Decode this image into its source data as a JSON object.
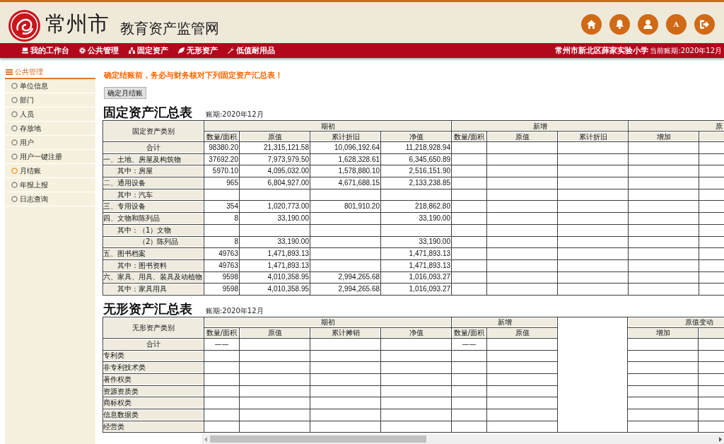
{
  "header": {
    "title": "常州市",
    "subtitle": "教育资产监管网",
    "letter_button": "A"
  },
  "nav": {
    "items": [
      "我的工作台",
      "公共管理",
      "固定资产",
      "无形资产",
      "低值耐用品"
    ],
    "school": "常州市新北区薛家实验小学",
    "period": "当前账期:2020年12月"
  },
  "sidebar": {
    "title": "公共管理",
    "items": [
      {
        "label": "单位信息",
        "selected": false
      },
      {
        "label": "部门",
        "selected": false
      },
      {
        "label": "人员",
        "selected": false
      },
      {
        "label": "存放地",
        "selected": false
      },
      {
        "label": "用户",
        "selected": false
      },
      {
        "label": "用户一键注册",
        "selected": false
      },
      {
        "label": "月结账",
        "selected": true
      },
      {
        "label": "年报上报",
        "selected": false
      },
      {
        "label": "日志查询",
        "selected": false
      }
    ]
  },
  "notice": "确定结账前，务必与财务核对下列固定资产汇总表！",
  "confirm_button": "确定月结账",
  "tables": [
    {
      "title": "固定资产汇总表",
      "period": "账期:2020年12月",
      "category_header": "固定资产类别",
      "groups": [
        {
          "kind": "group",
          "label": "期初",
          "columns": [
            "数量/面积",
            "原值",
            "累计折旧",
            "净值"
          ]
        },
        {
          "kind": "group",
          "label": "新增",
          "columns": [
            "数量/面积",
            "原值",
            "累计折旧"
          ]
        },
        {
          "kind": "group",
          "label": "原",
          "columns": [
            "增加",
            null
          ]
        }
      ],
      "rows": [
        {
          "kind": "total",
          "category": "合计",
          "cells": [
            "98380.20",
            "21,315,121.58",
            "10,096,192.64",
            "11,218,928.94"
          ]
        },
        {
          "kind": "category",
          "category": "一、土地、房屋及构筑物",
          "cells": [
            "37692.20",
            "7,973,979.50",
            "1,628,328.61",
            "6,345,650.89"
          ],
          "children": [
            {
              "kind": "item",
              "category": "其中：房屋",
              "cells": [
                "5970.10",
                "4,095,032.00",
                "1,578,880.10",
                "2,516,151.90"
              ]
            }
          ]
        },
        {
          "kind": "category",
          "category": "二、通用设备",
          "cells": [
            "965",
            "6,804,927.00",
            "4,671,688.15",
            "2,133,238.85"
          ],
          "children": [
            {
              "kind": "item",
              "category": "其中：汽车"
            }
          ]
        },
        {
          "kind": "category",
          "category": "三、专用设备",
          "cells": [
            "354",
            "1,020,773.00",
            "801,910.20",
            "218,862.80"
          ]
        },
        {
          "kind": "category",
          "category": "四、文物和陈列品",
          "cells": [
            "8",
            "33,190.00",
            null,
            "33,190.00"
          ],
          "children": [
            {
              "kind": "item",
              "category": "其中：（1）文物"
            },
            {
              "kind": "continuation",
              "category": "（2）陈列品",
              "cells": [
                "8",
                "33,190.00",
                null,
                "33,190.00"
              ]
            }
          ]
        },
        {
          "kind": "category",
          "category": "五、图书档案",
          "cells": [
            "49763",
            "1,471,893.13",
            null,
            "1,471,893.13"
          ],
          "children": [
            {
              "kind": "item",
              "category": "其中：图书资料",
              "cells": [
                "49763",
                "1,471,893.13",
                null,
                "1,471,893.13"
              ]
            }
          ]
        },
        {
          "kind": "category",
          "category": "六、家具、用具、装具及动植物",
          "cells": [
            "9598",
            "4,010,358.95",
            "2,994,265.68",
            "1,016,093.27"
          ],
          "children": [
            {
              "kind": "item",
              "category": "其中：家具用具",
              "cells": [
                "9598",
                "4,010,358.95",
                "2,994,265.68",
                "1,016,093.27"
              ]
            }
          ]
        }
      ]
    },
    {
      "title": "无形资产汇总表",
      "period": "账期:2020年12月",
      "category_header": "无形资产类别",
      "groups": [
        {
          "kind": "group",
          "label": "期初",
          "columns": [
            "数量/面积",
            "原值",
            "累计摊销",
            "净值"
          ]
        },
        {
          "kind": "group",
          "label": "新增",
          "columns": [
            "数量/面积",
            "原值"
          ]
        },
        {
          "kind": "spacer"
        },
        {
          "kind": "group",
          "label": "原值变动",
          "columns": [
            "增加",
            null
          ]
        }
      ],
      "rows": [
        {
          "kind": "total",
          "category": "合计",
          "cells": [
            "——",
            null,
            null,
            null,
            "——"
          ]
        },
        {
          "kind": "category",
          "category": "专利类"
        },
        {
          "kind": "category",
          "category": "非专利技术类"
        },
        {
          "kind": "category",
          "category": "著作权类"
        },
        {
          "kind": "category",
          "category": "资源资质类"
        },
        {
          "kind": "category",
          "category": "商标权类"
        },
        {
          "kind": "category",
          "category": "信息数据类"
        },
        {
          "kind": "category",
          "category": "经营类"
        }
      ]
    }
  ]
}
